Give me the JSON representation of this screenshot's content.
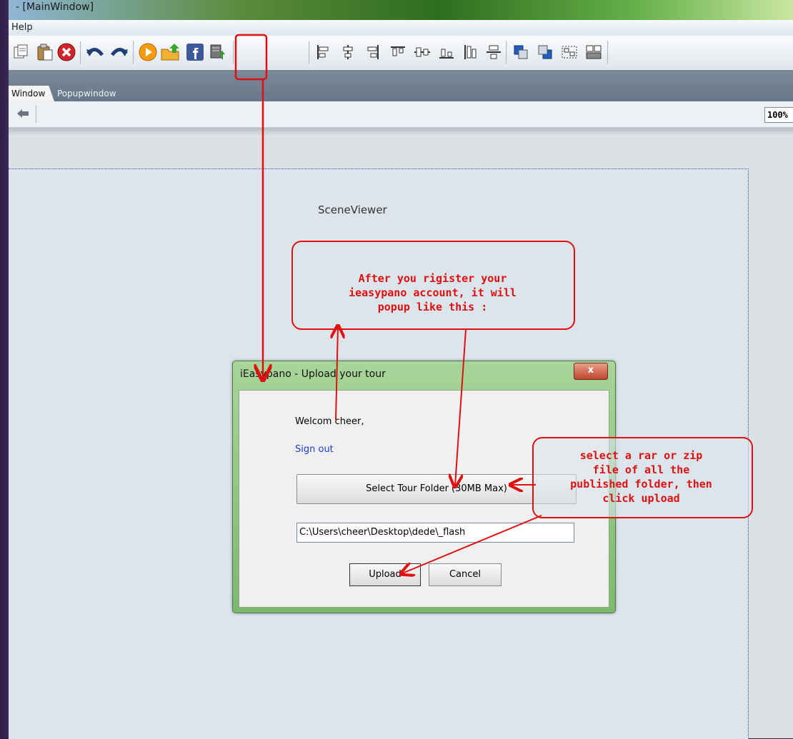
{
  "window": {
    "title": "- [MainWindow]"
  },
  "menu": {
    "help": "Help"
  },
  "tabs": [
    {
      "label": "Window"
    },
    {
      "label": "Popupwindow"
    }
  ],
  "nav": {
    "zoom": "100%"
  },
  "canvas": {
    "label": "SceneViewer"
  },
  "dialog": {
    "title": "iEasypano - Upload your tour",
    "close_label": "x",
    "welcome": "Welcom cheer,",
    "sign_out": "Sign out",
    "select_button": "Select Tour Folder (30MB Max)",
    "path_value": "C:\\Users\\cheer\\Desktop\\dede\\_flash",
    "upload_button": "Upload",
    "cancel_button": "Cancel"
  },
  "annotations": {
    "popup_note": [
      "After you rigister your",
      "ieasypano account, it will",
      "popup like this :"
    ],
    "select_note": [
      "select a rar or zip",
      "file of all the",
      "published folder, then",
      "click upload"
    ],
    "color": "#e01010"
  },
  "toolbar_icons": [
    "copy-icon",
    "paste-icon",
    "delete-icon",
    "undo-icon",
    "redo-icon",
    "play-icon",
    "publish-folder-icon",
    "facebook-icon",
    "export-icon",
    "align-left-icon",
    "align-center-icon",
    "align-right-icon",
    "align-top-icon",
    "align-middle-icon",
    "align-bottom-icon",
    "distribute-h-icon",
    "distribute-v-icon",
    "bring-front-icon",
    "send-back-icon",
    "group-icon",
    "ungroup-icon"
  ]
}
